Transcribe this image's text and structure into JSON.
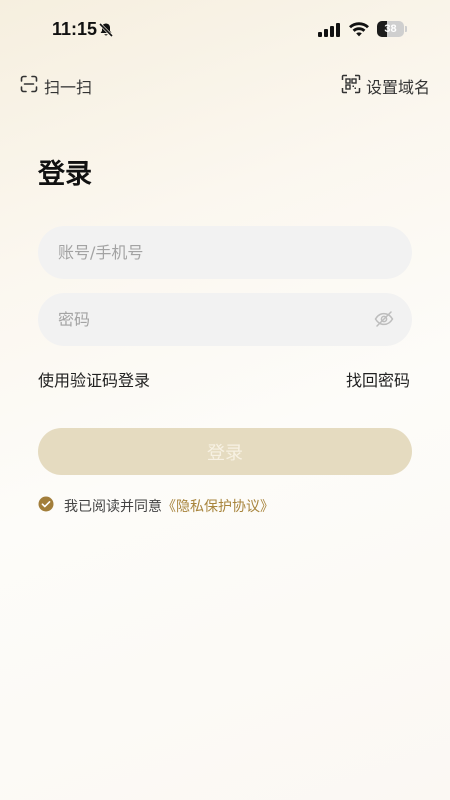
{
  "status_bar": {
    "time": "11:15",
    "battery_level": "38",
    "battery_fraction": 0.38
  },
  "header": {
    "scan_label": "扫一扫",
    "domain_label": "设置域名"
  },
  "login": {
    "title": "登录",
    "account_placeholder": "账号/手机号",
    "password_placeholder": "密码",
    "code_login_label": "使用验证码登录",
    "forgot_label": "找回密码",
    "submit_label": "登录"
  },
  "agreement": {
    "checked": true,
    "prefix": "我已阅读并同意",
    "link": "《隐私保护协议》"
  },
  "colors": {
    "accent_gold": "#a8853d",
    "button_disabled": "#e5dbc0",
    "check_fill": "#a27e3a"
  },
  "icons": [
    "bell-slash-icon",
    "signal-icon",
    "wifi-icon",
    "battery-icon",
    "scan-icon",
    "qr-code-icon",
    "eye-off-icon",
    "checkbox-checked-icon"
  ]
}
